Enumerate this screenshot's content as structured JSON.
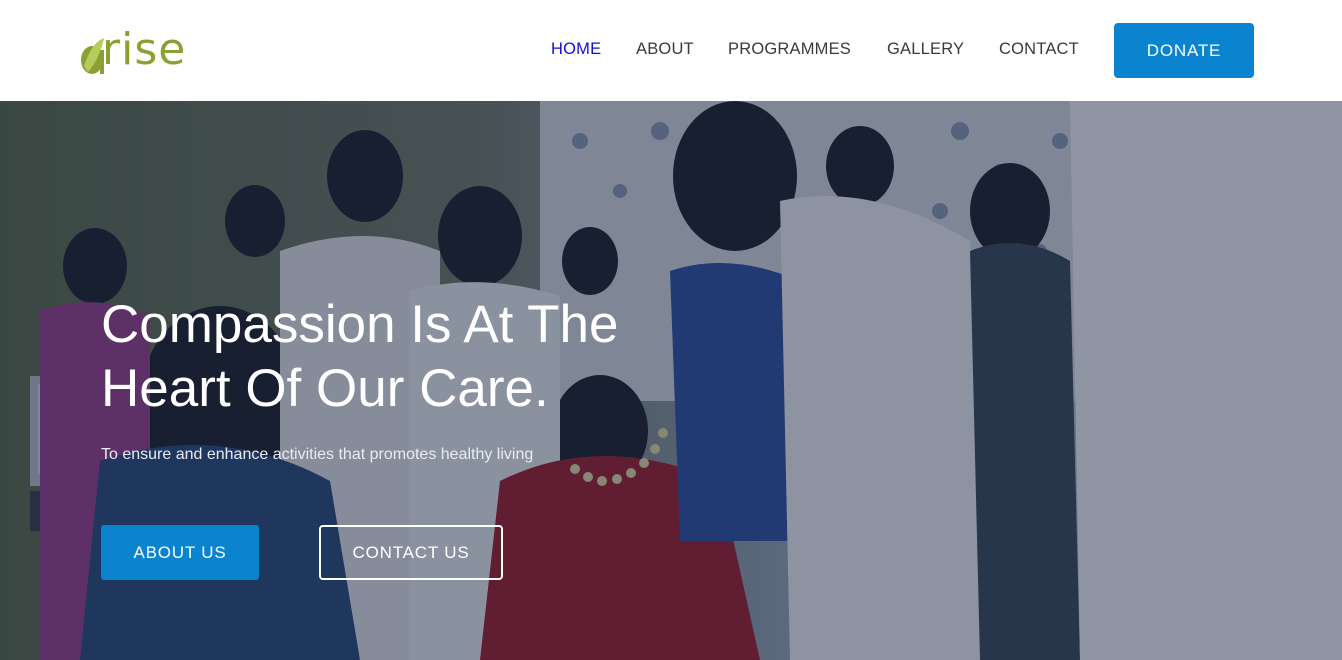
{
  "brand": {
    "logo_text": "rise",
    "logo_icon": "leaf-a-icon",
    "logo_color": "#8aa032"
  },
  "nav": {
    "items": [
      {
        "label": "HOME",
        "active": true
      },
      {
        "label": "ABOUT",
        "active": false
      },
      {
        "label": "PROGRAMMES",
        "active": false
      },
      {
        "label": "GALLERY",
        "active": false
      },
      {
        "label": "CONTACT",
        "active": false
      }
    ],
    "donate_label": "DONATE",
    "active_color": "#1010d8",
    "accent_color": "#0a84cf"
  },
  "hero": {
    "title_line1": "Compassion Is At The",
    "title_line2": "Heart Of Our Care.",
    "subtitle": "To ensure and enhance activities that promotes healthy living",
    "primary_button": "ABOUT US",
    "secondary_button": "CONTACT US"
  }
}
